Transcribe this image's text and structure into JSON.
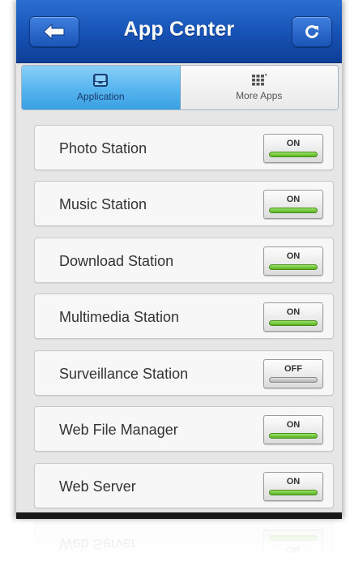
{
  "header": {
    "title": "App Center",
    "back_icon": "back-arrow-icon",
    "refresh_icon": "refresh-icon",
    "color": "#1651b4"
  },
  "tabs": [
    {
      "label": "Application",
      "icon": "inbox-icon",
      "active": true
    },
    {
      "label": "More Apps",
      "icon": "grid-icon",
      "active": false
    }
  ],
  "apps": [
    {
      "name": "Photo Station",
      "state": "ON"
    },
    {
      "name": "Music Station",
      "state": "ON"
    },
    {
      "name": "Download Station",
      "state": "ON"
    },
    {
      "name": "Multimedia Station",
      "state": "ON"
    },
    {
      "name": "Surveillance Station",
      "state": "OFF"
    },
    {
      "name": "Web File Manager",
      "state": "ON"
    },
    {
      "name": "Web Server",
      "state": "ON"
    }
  ],
  "colors": {
    "on_indicator": "#58b11f",
    "off_indicator": "#b5b5b5",
    "active_tab": "#55b4ee"
  }
}
